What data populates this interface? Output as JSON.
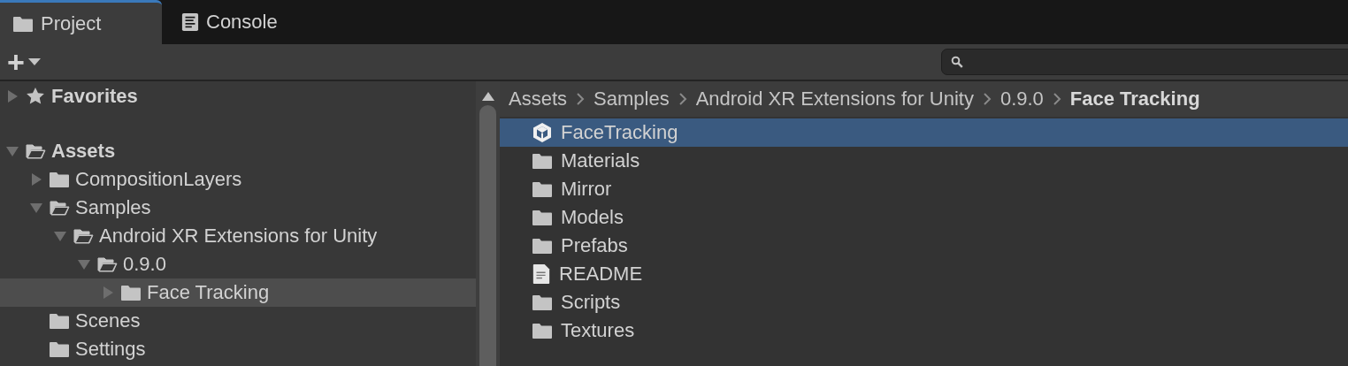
{
  "tabs": [
    {
      "label": "Project",
      "kind": "folder",
      "selected": true
    },
    {
      "label": "Console",
      "kind": "console",
      "selected": false
    }
  ],
  "toolbar": {
    "add_button": "+"
  },
  "tree": [
    {
      "label": "Favorites",
      "kind": "favorites",
      "expanded": false,
      "selected": false
    },
    {
      "label": "Assets",
      "kind": "folder",
      "expanded": true,
      "selected": false,
      "children": [
        {
          "label": "CompositionLayers",
          "kind": "folder",
          "expanded": false,
          "selected": false
        },
        {
          "label": "Samples",
          "kind": "folder",
          "expanded": true,
          "selected": false,
          "children": [
            {
              "label": "Android XR Extensions for Unity",
              "kind": "folder",
              "expanded": true,
              "selected": false,
              "children": [
                {
                  "label": "0.9.0",
                  "kind": "folder",
                  "expanded": true,
                  "selected": false,
                  "children": [
                    {
                      "label": "Face Tracking",
                      "kind": "folder",
                      "expanded": false,
                      "selected": true
                    }
                  ]
                }
              ]
            }
          ]
        },
        {
          "label": "Scenes",
          "kind": "folder",
          "selected": false
        },
        {
          "label": "Settings",
          "kind": "folder",
          "selected": false
        }
      ]
    }
  ],
  "breadcrumb": [
    {
      "label": "Assets",
      "current": false
    },
    {
      "label": "Samples",
      "current": false
    },
    {
      "label": "Android XR Extensions for Unity",
      "current": false
    },
    {
      "label": "0.9.0",
      "current": false
    },
    {
      "label": "Face Tracking",
      "current": true
    }
  ],
  "files": [
    {
      "name": "FaceTracking",
      "kind": "prefab",
      "selected": true
    },
    {
      "name": "Materials",
      "kind": "folder",
      "selected": false
    },
    {
      "name": "Mirror",
      "kind": "folder",
      "selected": false
    },
    {
      "name": "Models",
      "kind": "folder",
      "selected": false
    },
    {
      "name": "Prefabs",
      "kind": "folder",
      "selected": false
    },
    {
      "name": "README",
      "kind": "text",
      "selected": false
    },
    {
      "name": "Scripts",
      "kind": "folder",
      "selected": false
    },
    {
      "name": "Textures",
      "kind": "folder",
      "selected": false
    }
  ]
}
